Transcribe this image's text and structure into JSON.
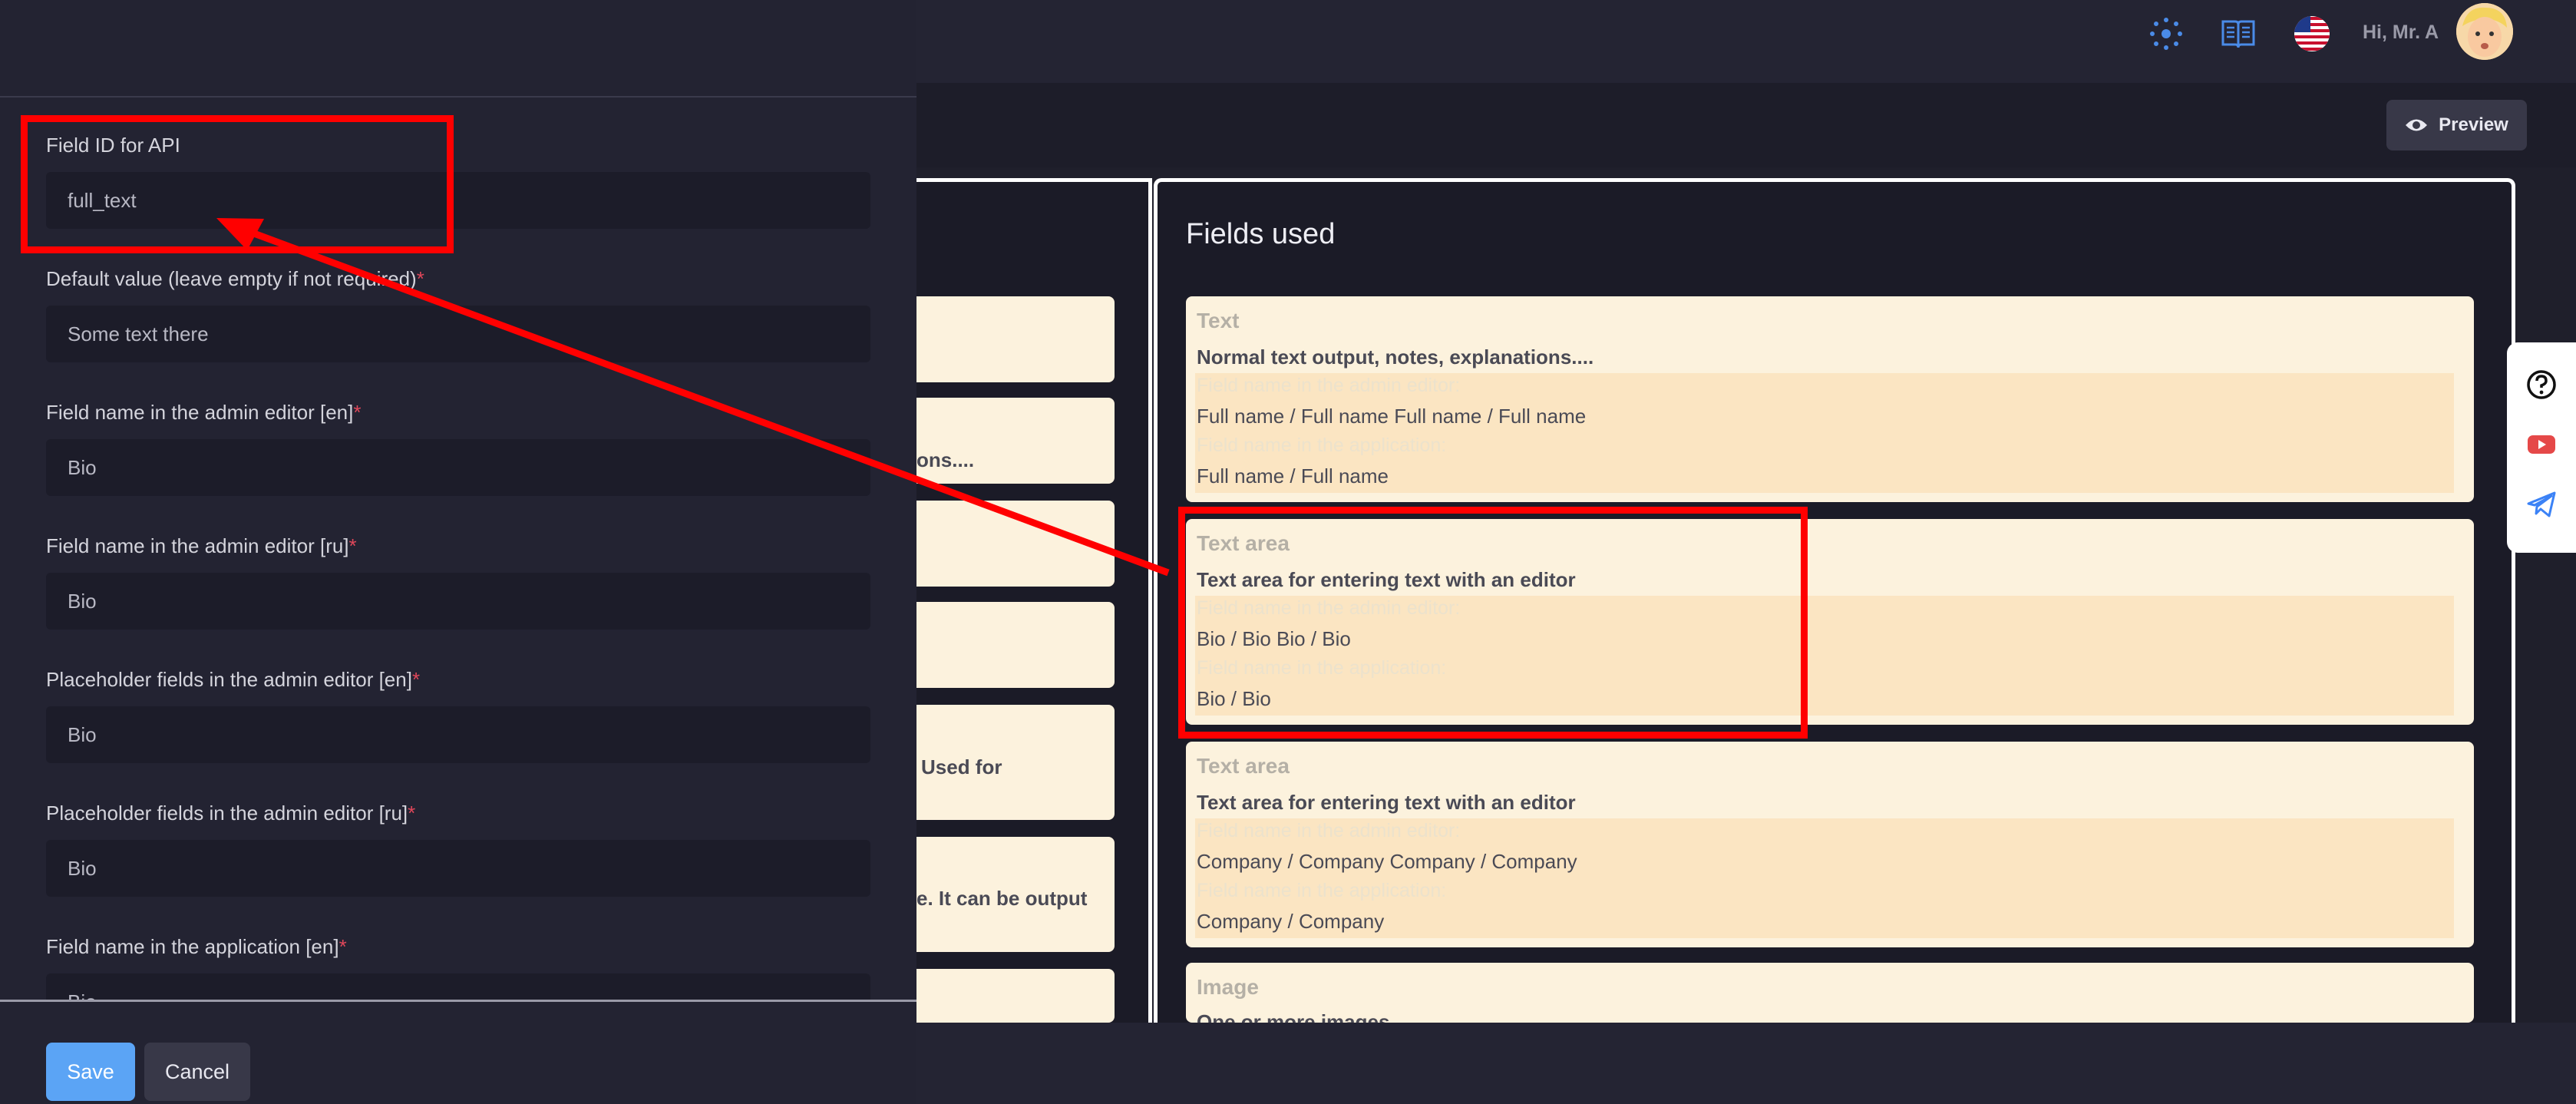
{
  "header": {
    "greeting": "Hi, Mr. A",
    "icons": [
      "spinner-icon",
      "book-icon",
      "us-flag-icon",
      "avatar"
    ]
  },
  "toolbar": {
    "preview_label": "Preview"
  },
  "fields_panel": {
    "title": "Fields used",
    "left_cards_partial": [
      "ons....",
      "Used for",
      "e. It can be output"
    ],
    "cards": [
      {
        "type": "Text",
        "description": "Normal text output, notes, explanations....",
        "admin_label": "Field name in the admin editor:",
        "admin_value": "Full name / Full name Full name / Full name",
        "app_label": "Field name in the application:",
        "app_value": "Full name / Full name"
      },
      {
        "type": "Text area",
        "description": "Text area for entering text with an editor",
        "admin_label": "Field name in the admin editor:",
        "admin_value": "Bio / Bio Bio / Bio",
        "app_label": "Field name in the application:",
        "app_value": "Bio / Bio"
      },
      {
        "type": "Text area",
        "description": "Text area for entering text with an editor",
        "admin_label": "Field name in the admin editor:",
        "admin_value": "Company / Company Company / Company",
        "app_label": "Field name in the application:",
        "app_value": "Company / Company"
      },
      {
        "type": "Image",
        "description": "One or more images"
      }
    ]
  },
  "side_tools": [
    "help-icon",
    "youtube-icon",
    "telegram-icon"
  ],
  "drawer": {
    "fields": [
      {
        "label": "Field ID for API",
        "required": false,
        "value": "full_text"
      },
      {
        "label": "Default value (leave empty if not required)",
        "required": true,
        "value": "Some text there"
      },
      {
        "label": "Field name in the admin editor [en]",
        "required": true,
        "value": "Bio"
      },
      {
        "label": "Field name in the admin editor [ru]",
        "required": true,
        "value": "Bio"
      },
      {
        "label": "Placeholder fields in the admin editor [en]",
        "required": true,
        "value": "Bio"
      },
      {
        "label": "Placeholder fields in the admin editor [ru]",
        "required": true,
        "value": "Bio"
      },
      {
        "label": "Field name in the application [en]",
        "required": true,
        "value": "Bio"
      }
    ],
    "required_mark": "*",
    "save_label": "Save",
    "cancel_label": "Cancel"
  },
  "colors": {
    "annotation": "#ff0000",
    "card_bg": "#fcf2dd",
    "card_band": "#fbe5c2",
    "primary_button": "#5ba4f5"
  }
}
